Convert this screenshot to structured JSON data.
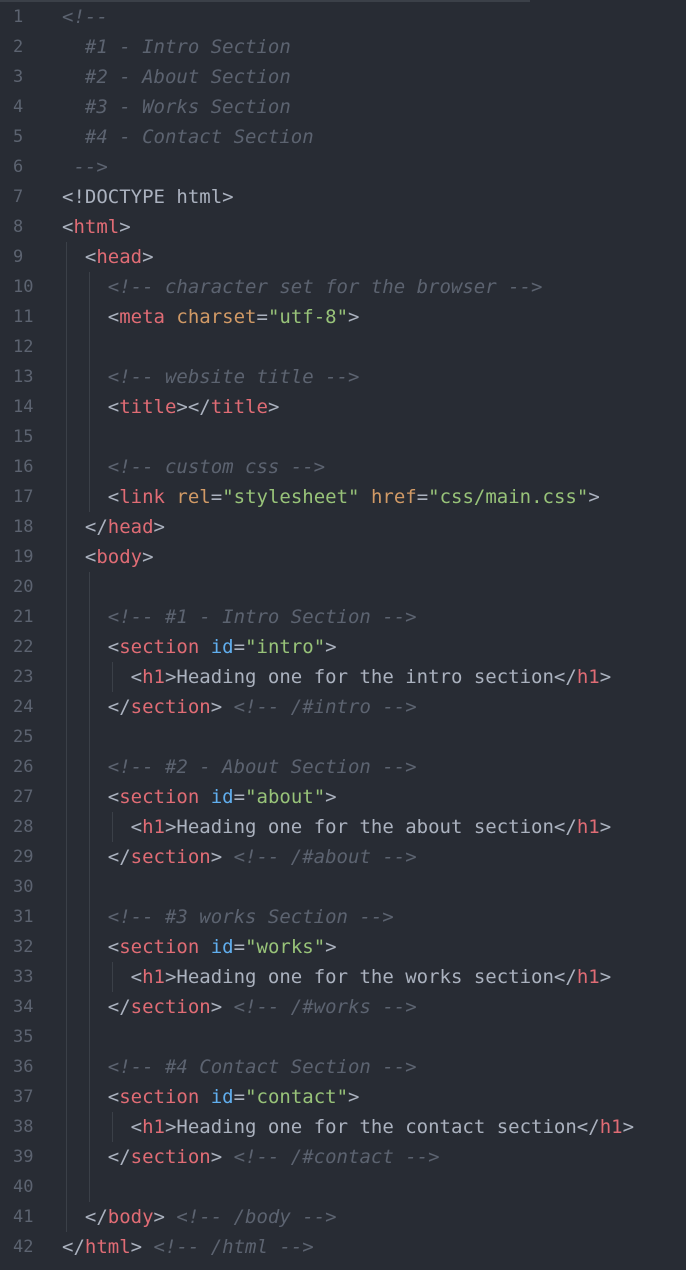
{
  "editor": {
    "language": "html",
    "colors": {
      "background": "#282c34",
      "line_number": "#5c6370",
      "comment": "#5c6370",
      "tag": "#e06c75",
      "attribute": "#d19a66",
      "id_attribute": "#61afef",
      "string": "#98c379",
      "text": "#abb2bf"
    },
    "lines": [
      {
        "n": "1",
        "indent": 0,
        "guides": 0,
        "tokens": [
          {
            "t": "cm",
            "v": "<!--"
          }
        ]
      },
      {
        "n": "2",
        "indent": 2,
        "guides": 0,
        "tokens": [
          {
            "t": "cm",
            "v": "#1 - Intro Section"
          }
        ]
      },
      {
        "n": "3",
        "indent": 2,
        "guides": 0,
        "tokens": [
          {
            "t": "cm",
            "v": "#2 - About Section"
          }
        ]
      },
      {
        "n": "4",
        "indent": 2,
        "guides": 0,
        "tokens": [
          {
            "t": "cm",
            "v": "#3 - Works Section"
          }
        ]
      },
      {
        "n": "5",
        "indent": 2,
        "guides": 0,
        "tokens": [
          {
            "t": "cm",
            "v": "#4 - Contact Section"
          }
        ]
      },
      {
        "n": "6",
        "indent": 1,
        "guides": 0,
        "tokens": [
          {
            "t": "cm",
            "v": "-->"
          }
        ]
      },
      {
        "n": "7",
        "indent": 0,
        "guides": 0,
        "tokens": [
          {
            "t": "pu",
            "v": "<!DOCTYPE html>"
          }
        ]
      },
      {
        "n": "8",
        "indent": 0,
        "guides": 0,
        "tokens": [
          {
            "t": "pu",
            "v": "<"
          },
          {
            "t": "tg",
            "v": "html"
          },
          {
            "t": "pu",
            "v": ">"
          }
        ]
      },
      {
        "n": "9",
        "indent": 2,
        "guides": 1,
        "tokens": [
          {
            "t": "pu",
            "v": "<"
          },
          {
            "t": "tg",
            "v": "head"
          },
          {
            "t": "pu",
            "v": ">"
          }
        ]
      },
      {
        "n": "10",
        "indent": 4,
        "guides": 2,
        "tokens": [
          {
            "t": "cm",
            "v": "<!-- character set for the browser -->"
          }
        ]
      },
      {
        "n": "11",
        "indent": 4,
        "guides": 2,
        "tokens": [
          {
            "t": "pu",
            "v": "<"
          },
          {
            "t": "tg",
            "v": "meta"
          },
          {
            "t": "pu",
            "v": " "
          },
          {
            "t": "at",
            "v": "charset"
          },
          {
            "t": "pu",
            "v": "="
          },
          {
            "t": "st",
            "v": "\"utf-8\""
          },
          {
            "t": "pu",
            "v": ">"
          }
        ]
      },
      {
        "n": "12",
        "indent": 0,
        "guides": 2,
        "tokens": []
      },
      {
        "n": "13",
        "indent": 4,
        "guides": 2,
        "tokens": [
          {
            "t": "cm",
            "v": "<!-- website title -->"
          }
        ]
      },
      {
        "n": "14",
        "indent": 4,
        "guides": 2,
        "tokens": [
          {
            "t": "pu",
            "v": "<"
          },
          {
            "t": "tg",
            "v": "title"
          },
          {
            "t": "pu",
            "v": "></"
          },
          {
            "t": "tg",
            "v": "title"
          },
          {
            "t": "pu",
            "v": ">"
          }
        ]
      },
      {
        "n": "15",
        "indent": 0,
        "guides": 2,
        "tokens": []
      },
      {
        "n": "16",
        "indent": 4,
        "guides": 2,
        "tokens": [
          {
            "t": "cm",
            "v": "<!-- custom css -->"
          }
        ]
      },
      {
        "n": "17",
        "indent": 4,
        "guides": 2,
        "tokens": [
          {
            "t": "pu",
            "v": "<"
          },
          {
            "t": "tg",
            "v": "link"
          },
          {
            "t": "pu",
            "v": " "
          },
          {
            "t": "at",
            "v": "rel"
          },
          {
            "t": "pu",
            "v": "="
          },
          {
            "t": "st",
            "v": "\"stylesheet\""
          },
          {
            "t": "pu",
            "v": " "
          },
          {
            "t": "at",
            "v": "href"
          },
          {
            "t": "pu",
            "v": "="
          },
          {
            "t": "st",
            "v": "\"css/main.css\""
          },
          {
            "t": "pu",
            "v": ">"
          }
        ]
      },
      {
        "n": "18",
        "indent": 2,
        "guides": 1,
        "tokens": [
          {
            "t": "pu",
            "v": "</"
          },
          {
            "t": "tg",
            "v": "head"
          },
          {
            "t": "pu",
            "v": ">"
          }
        ]
      },
      {
        "n": "19",
        "indent": 2,
        "guides": 1,
        "tokens": [
          {
            "t": "pu",
            "v": "<"
          },
          {
            "t": "tg",
            "v": "body"
          },
          {
            "t": "pu",
            "v": ">"
          }
        ]
      },
      {
        "n": "20",
        "indent": 0,
        "guides": 2,
        "tokens": []
      },
      {
        "n": "21",
        "indent": 4,
        "guides": 2,
        "tokens": [
          {
            "t": "cm",
            "v": "<!-- #1 - Intro Section -->"
          }
        ]
      },
      {
        "n": "22",
        "indent": 4,
        "guides": 2,
        "tokens": [
          {
            "t": "pu",
            "v": "<"
          },
          {
            "t": "tg",
            "v": "section"
          },
          {
            "t": "pu",
            "v": " "
          },
          {
            "t": "idat",
            "v": "id"
          },
          {
            "t": "pu",
            "v": "="
          },
          {
            "t": "st",
            "v": "\"intro\""
          },
          {
            "t": "pu",
            "v": ">"
          }
        ]
      },
      {
        "n": "23",
        "indent": 6,
        "guides": 3,
        "tokens": [
          {
            "t": "pu",
            "v": "<"
          },
          {
            "t": "tg",
            "v": "h1"
          },
          {
            "t": "pu",
            "v": ">"
          },
          {
            "t": "tx",
            "v": "Heading one for the intro section"
          },
          {
            "t": "pu",
            "v": "</"
          },
          {
            "t": "tg",
            "v": "h1"
          },
          {
            "t": "pu",
            "v": ">"
          }
        ]
      },
      {
        "n": "24",
        "indent": 4,
        "guides": 2,
        "tokens": [
          {
            "t": "pu",
            "v": "</"
          },
          {
            "t": "tg",
            "v": "section"
          },
          {
            "t": "pu",
            "v": "> "
          },
          {
            "t": "cm",
            "v": "<!-- /#intro -->"
          }
        ]
      },
      {
        "n": "25",
        "indent": 0,
        "guides": 2,
        "tokens": []
      },
      {
        "n": "26",
        "indent": 4,
        "guides": 2,
        "tokens": [
          {
            "t": "cm",
            "v": "<!-- #2 - About Section -->"
          }
        ]
      },
      {
        "n": "27",
        "indent": 4,
        "guides": 2,
        "tokens": [
          {
            "t": "pu",
            "v": "<"
          },
          {
            "t": "tg",
            "v": "section"
          },
          {
            "t": "pu",
            "v": " "
          },
          {
            "t": "idat",
            "v": "id"
          },
          {
            "t": "pu",
            "v": "="
          },
          {
            "t": "st",
            "v": "\"about\""
          },
          {
            "t": "pu",
            "v": ">"
          }
        ]
      },
      {
        "n": "28",
        "indent": 6,
        "guides": 3,
        "tokens": [
          {
            "t": "pu",
            "v": "<"
          },
          {
            "t": "tg",
            "v": "h1"
          },
          {
            "t": "pu",
            "v": ">"
          },
          {
            "t": "tx",
            "v": "Heading one for the about section"
          },
          {
            "t": "pu",
            "v": "</"
          },
          {
            "t": "tg",
            "v": "h1"
          },
          {
            "t": "pu",
            "v": ">"
          }
        ]
      },
      {
        "n": "29",
        "indent": 4,
        "guides": 2,
        "tokens": [
          {
            "t": "pu",
            "v": "</"
          },
          {
            "t": "tg",
            "v": "section"
          },
          {
            "t": "pu",
            "v": "> "
          },
          {
            "t": "cm",
            "v": "<!-- /#about -->"
          }
        ]
      },
      {
        "n": "30",
        "indent": 0,
        "guides": 2,
        "tokens": []
      },
      {
        "n": "31",
        "indent": 4,
        "guides": 2,
        "tokens": [
          {
            "t": "cm",
            "v": "<!-- #3 works Section -->"
          }
        ]
      },
      {
        "n": "32",
        "indent": 4,
        "guides": 2,
        "tokens": [
          {
            "t": "pu",
            "v": "<"
          },
          {
            "t": "tg",
            "v": "section"
          },
          {
            "t": "pu",
            "v": " "
          },
          {
            "t": "idat",
            "v": "id"
          },
          {
            "t": "pu",
            "v": "="
          },
          {
            "t": "st",
            "v": "\"works\""
          },
          {
            "t": "pu",
            "v": ">"
          }
        ]
      },
      {
        "n": "33",
        "indent": 6,
        "guides": 3,
        "tokens": [
          {
            "t": "pu",
            "v": "<"
          },
          {
            "t": "tg",
            "v": "h1"
          },
          {
            "t": "pu",
            "v": ">"
          },
          {
            "t": "tx",
            "v": "Heading one for the works section"
          },
          {
            "t": "pu",
            "v": "</"
          },
          {
            "t": "tg",
            "v": "h1"
          },
          {
            "t": "pu",
            "v": ">"
          }
        ]
      },
      {
        "n": "34",
        "indent": 4,
        "guides": 2,
        "tokens": [
          {
            "t": "pu",
            "v": "</"
          },
          {
            "t": "tg",
            "v": "section"
          },
          {
            "t": "pu",
            "v": "> "
          },
          {
            "t": "cm",
            "v": "<!-- /#works -->"
          }
        ]
      },
      {
        "n": "35",
        "indent": 0,
        "guides": 2,
        "tokens": []
      },
      {
        "n": "36",
        "indent": 4,
        "guides": 2,
        "tokens": [
          {
            "t": "cm",
            "v": "<!-- #4 Contact Section -->"
          }
        ]
      },
      {
        "n": "37",
        "indent": 4,
        "guides": 2,
        "tokens": [
          {
            "t": "pu",
            "v": "<"
          },
          {
            "t": "tg",
            "v": "section"
          },
          {
            "t": "pu",
            "v": " "
          },
          {
            "t": "idat",
            "v": "id"
          },
          {
            "t": "pu",
            "v": "="
          },
          {
            "t": "st",
            "v": "\"contact\""
          },
          {
            "t": "pu",
            "v": ">"
          }
        ]
      },
      {
        "n": "38",
        "indent": 6,
        "guides": 3,
        "tokens": [
          {
            "t": "pu",
            "v": "<"
          },
          {
            "t": "tg",
            "v": "h1"
          },
          {
            "t": "pu",
            "v": ">"
          },
          {
            "t": "tx",
            "v": "Heading one for the contact section"
          },
          {
            "t": "pu",
            "v": "</"
          },
          {
            "t": "tg",
            "v": "h1"
          },
          {
            "t": "pu",
            "v": ">"
          }
        ]
      },
      {
        "n": "39",
        "indent": 4,
        "guides": 2,
        "tokens": [
          {
            "t": "pu",
            "v": "</"
          },
          {
            "t": "tg",
            "v": "section"
          },
          {
            "t": "pu",
            "v": "> "
          },
          {
            "t": "cm",
            "v": "<!-- /#contact -->"
          }
        ]
      },
      {
        "n": "40",
        "indent": 0,
        "guides": 2,
        "tokens": []
      },
      {
        "n": "41",
        "indent": 2,
        "guides": 1,
        "tokens": [
          {
            "t": "pu",
            "v": "</"
          },
          {
            "t": "tg",
            "v": "body"
          },
          {
            "t": "pu",
            "v": "> "
          },
          {
            "t": "cm",
            "v": "<!-- /body -->"
          }
        ]
      },
      {
        "n": "42",
        "indent": 0,
        "guides": 0,
        "tokens": [
          {
            "t": "pu",
            "v": "</"
          },
          {
            "t": "tg",
            "v": "html"
          },
          {
            "t": "pu",
            "v": "> "
          },
          {
            "t": "cm",
            "v": "<!-- /html -->"
          }
        ]
      }
    ]
  }
}
